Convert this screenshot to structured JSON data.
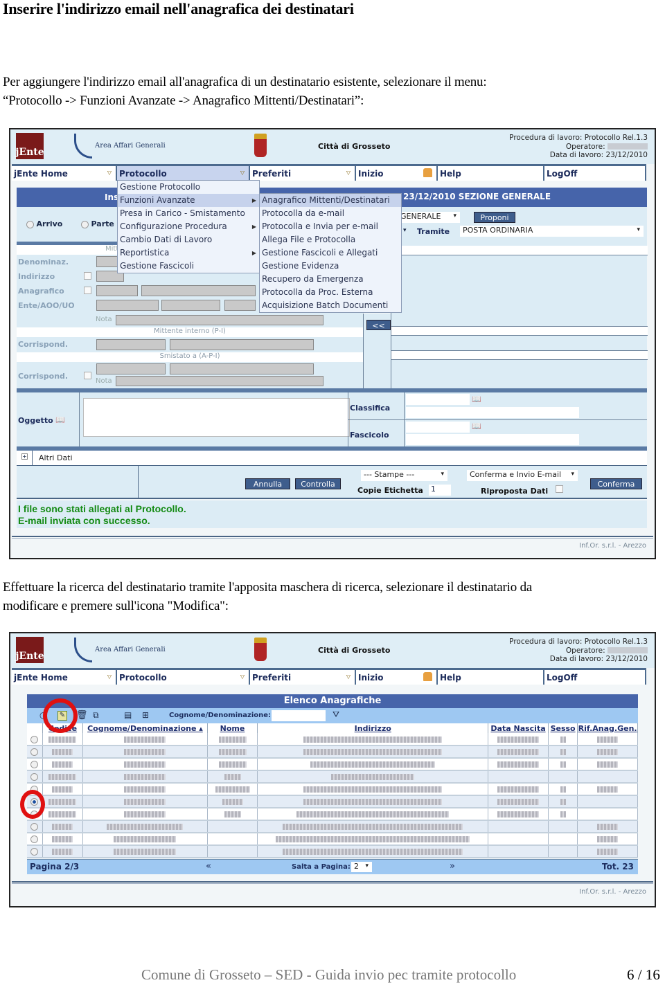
{
  "doc": {
    "title": "Inserire l'indirizzo email nell'anagrafica dei destinatari",
    "para1_line1": "Per aggiungere l'indirizzo email all'anagrafica di un destinatario esistente, selezionare il menu:",
    "para1_line2": "“Protocollo -> Funzioni Avanzate -> Anagrafico Mittenti/Destinatari”:",
    "para2_line1": "Effettuare la ricerca del destinatario tramite l'apposita maschera di ricerca, selezionare il destinatario da",
    "para2_line2": "modificare e premere sull'icona \"Modifica\":",
    "footer": "Comune di Grosseto – SED - Guida invio pec tramite protocollo",
    "page": "6 / 16"
  },
  "app": {
    "logo_text": "jEnte",
    "area": "Area Affari Generali",
    "city": "Città di Grosseto",
    "procedure": "Procedura di lavoro: Protocollo Rel.1.3",
    "operator_label": "Operatore:",
    "work_date": "Data di lavoro: 23/12/2010",
    "nav": [
      "jEnte Home",
      "Protocollo",
      "Preferiti",
      "Inizio",
      "Help",
      "LogOff"
    ],
    "credit": "Inf.Or. s.r.l. - Arezzo"
  },
  "shot1": {
    "header_partial": "Ins",
    "header_right": "23/12/2010 SEZIONE GENERALE",
    "radio_arrivo": "Arrivo",
    "radio_partenza": "Parte",
    "sezione_value": "GENERALE",
    "proponi": "Proponi",
    "tramite_label": "Tramite",
    "tramite_value": "POSTA ORDINARIA",
    "mitt_partial": "Mitt",
    "labels": [
      "Denominaz.",
      "Indirizzo",
      "Anagrafico",
      "Ente/AOO/UO"
    ],
    "nota": "Nota",
    "mittente_interno": "Mittente interno (P-I)",
    "corrispond": "Corrispond.",
    "smistato": "Smistato a (A-P-I)",
    "move_btn": "<<",
    "oggetto": "Oggetto",
    "classifica": "Classifica",
    "fascicolo": "Fascicolo",
    "altri_dati": "Altri Dati",
    "annulla": "Annulla",
    "controlla": "Controlla",
    "stampe": "--- Stampe ---",
    "copie_label": "Copie Etichetta",
    "copie_value": "1",
    "conferma_invio": "Conferma e Invio E-mail",
    "riproposta": "Riproposta Dati",
    "conferma": "Conferma",
    "msg1": "I file sono stati allegati al Protocollo.",
    "msg2": "E-mail inviata con successo.",
    "menu_protocollo": [
      {
        "label": "Gestione Protocollo",
        "sub": false
      },
      {
        "label": "Funzioni Avanzate",
        "sub": true
      },
      {
        "label": "Presa in Carico - Smistamento",
        "sub": false
      },
      {
        "label": "Configurazione Procedura",
        "sub": true
      },
      {
        "label": "Cambio Dati di Lavoro",
        "sub": false
      },
      {
        "label": "Reportistica",
        "sub": true
      },
      {
        "label": "Gestione Fascicoli",
        "sub": false
      }
    ],
    "menu_funzioni": [
      "Anagrafico Mittenti/Destinatari",
      "Protocolla da e-mail",
      "Protocolla e Invia per e-mail",
      "Allega File e Protocolla",
      "Gestione Fascicoli e Allegati",
      "Gestione Evidenza",
      "Recupero da Emergenza",
      "Protocolla da Proc. Esterna",
      "Acquisizione Batch Documenti"
    ]
  },
  "shot2": {
    "title": "Elenco Anagrafiche",
    "filter_label": "Cognome/Denominazione:",
    "filter_value": "",
    "columns": [
      "Codice",
      "Cognome/Denominazione ▴",
      "Nome",
      "Indirizzo",
      "Data Nascita",
      "Sesso",
      "Rif.Anag.Gen."
    ],
    "rows_count": 10,
    "selected_row": 6,
    "pagina": "Pagina 2/3",
    "salta_label": "Salta a Pagina:",
    "salta_value": "2",
    "totale": "Tot. 23"
  }
}
